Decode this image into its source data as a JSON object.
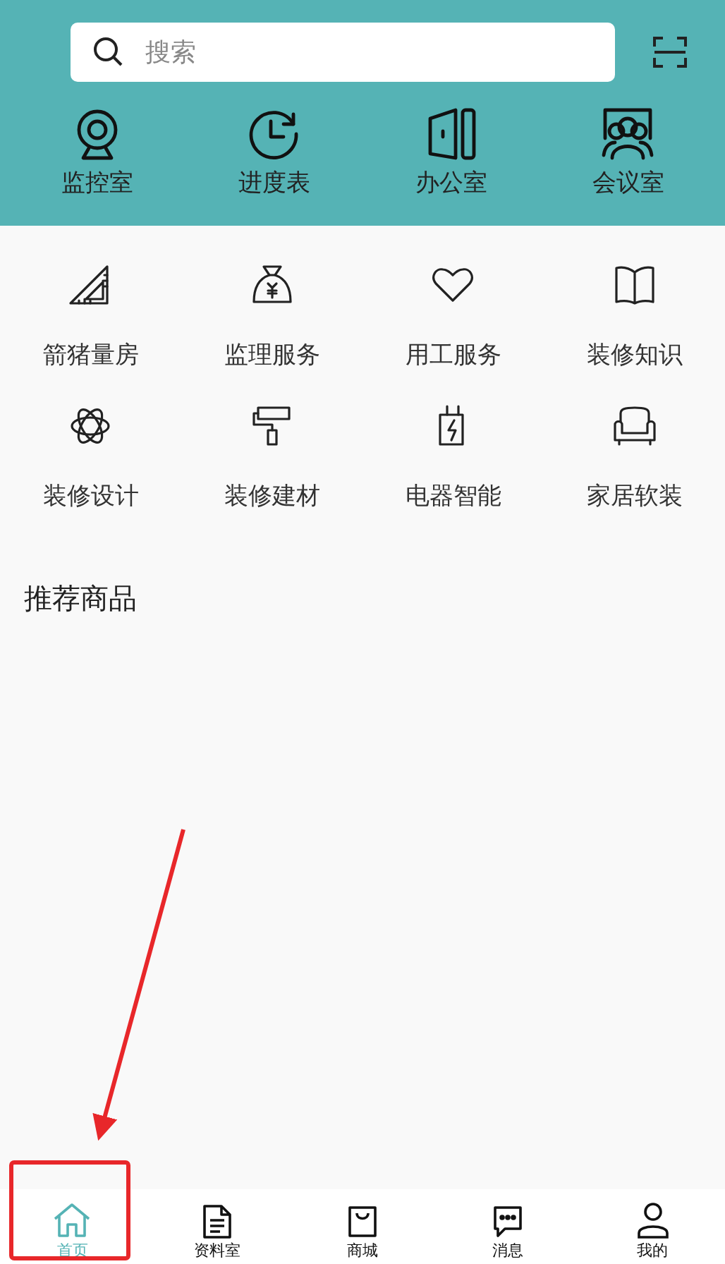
{
  "search": {
    "placeholder": "搜索"
  },
  "quick_links": [
    {
      "label": "监控室"
    },
    {
      "label": "进度表"
    },
    {
      "label": "办公室"
    },
    {
      "label": "会议室"
    }
  ],
  "services": [
    {
      "label": "箭猪量房"
    },
    {
      "label": "监理服务"
    },
    {
      "label": "用工服务"
    },
    {
      "label": "装修知识"
    },
    {
      "label": "装修设计"
    },
    {
      "label": "装修建材"
    },
    {
      "label": "电器智能"
    },
    {
      "label": "家居软装"
    }
  ],
  "section_title": "推荐商品",
  "tab_bar": [
    {
      "label": "首页",
      "selected": true
    },
    {
      "label": "资料室",
      "selected": false
    },
    {
      "label": "商城",
      "selected": false
    },
    {
      "label": "消息",
      "selected": false
    },
    {
      "label": "我的",
      "selected": false
    }
  ]
}
